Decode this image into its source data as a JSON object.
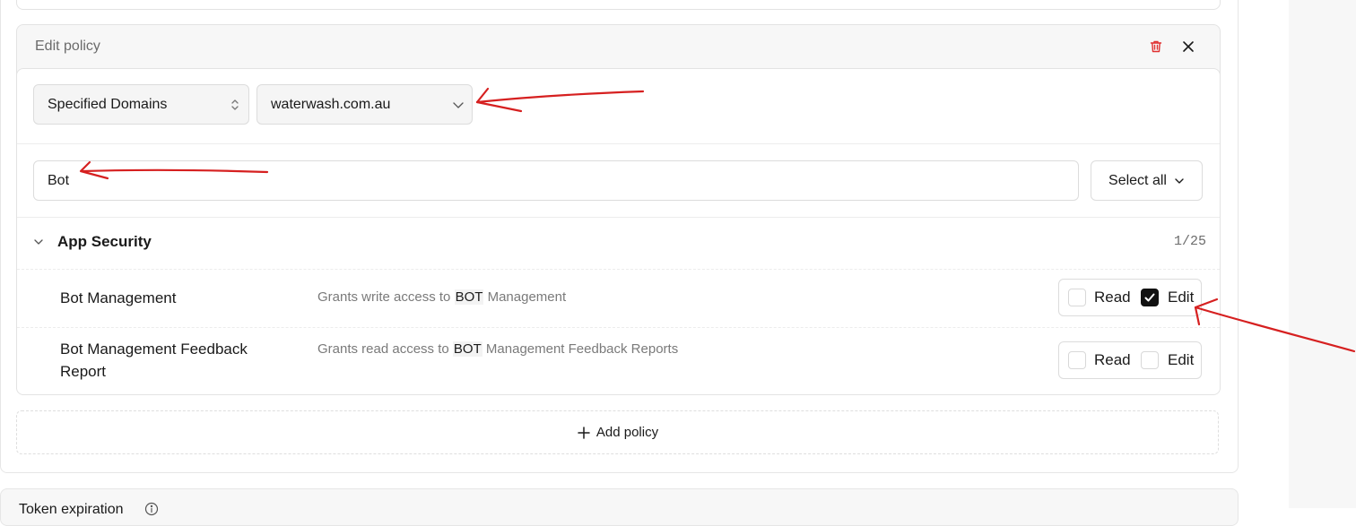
{
  "policy_card": {
    "title": "Edit policy"
  },
  "scope_select": {
    "value": "Specified Domains"
  },
  "domain_select": {
    "value": "waterwash.com.au"
  },
  "search": {
    "value": "Bot",
    "placeholder": ""
  },
  "select_all": {
    "label": "Select all"
  },
  "group": {
    "title": "App Security",
    "count": "1/25"
  },
  "permissions": [
    {
      "name": "Bot Management",
      "desc_prefix": "Grants write access to ",
      "desc_highlight": "BOT",
      "desc_suffix": " Management",
      "read_label": "Read",
      "edit_label": "Edit",
      "read_checked": false,
      "edit_checked": true
    },
    {
      "name": "Bot Management Feedback Report",
      "desc_prefix": "Grants read access to ",
      "desc_highlight": "BOT",
      "desc_suffix": " Management Feedback Reports",
      "read_label": "Read",
      "edit_label": "Edit",
      "read_checked": false,
      "edit_checked": false
    }
  ],
  "add_policy": {
    "label": "Add policy"
  },
  "next_section": {
    "title": "Token expiration"
  },
  "icons": {
    "trash": "trash-icon",
    "close": "close-icon",
    "updown": "chevron-updown-icon",
    "chevron": "chevron-down-icon",
    "plus": "plus-icon",
    "info": "info-icon",
    "check": "check-icon"
  },
  "colors": {
    "danger": "#e03131",
    "annotation": "#d62020",
    "checked": "#111111"
  }
}
